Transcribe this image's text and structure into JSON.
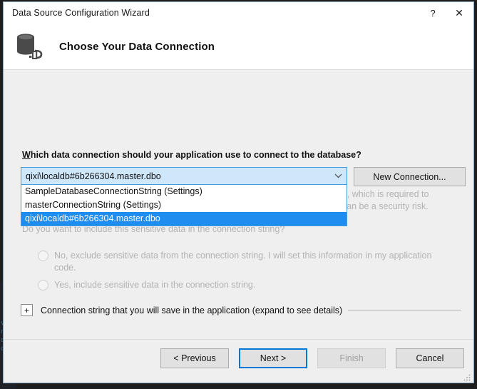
{
  "window": {
    "title": "Data Source Configuration Wizard",
    "help_label": "?",
    "close_label": "✕"
  },
  "header": {
    "title": "Choose Your Data Connection",
    "icon": "database-connection-icon"
  },
  "main": {
    "question_label_prefix": "W",
    "question_label_rest": "hich data connection should your application use to connect to the database?",
    "combo": {
      "value": "qixi\\localdb#6b266304.master.dbo",
      "placeholder": "qixi\\localdb#6b266304.master.dbo",
      "arrow_icon": "chevron-down-icon",
      "expanded": true,
      "options": [
        {
          "label": "SampleDatabaseConnectionString (Settings)",
          "selected": false
        },
        {
          "label": "masterConnectionString (Settings)",
          "selected": false
        },
        {
          "label": "qixi\\localdb#6b266304.master.dbo",
          "selected": true
        }
      ]
    },
    "new_connection_label": "New Connection...",
    "sensitive_paragraph": "This connection string appears to contain sensitive data (for example, a password), which is required to connect to the database. However, storing sensitive data in the connection string can be a security risk.",
    "sensitive_question": "Do you want to include this sensitive data in the connection string?",
    "radios": [
      {
        "id": "exclude-sensitive",
        "label": "No, exclude sensitive data from the connection string. I will set this information in my application code.",
        "selected": false,
        "disabled": true
      },
      {
        "id": "include-sensitive",
        "label": "Yes, include sensitive data in the connection string.",
        "selected": false,
        "disabled": true
      }
    ],
    "expander": {
      "toggle_label": "+",
      "text": "Connection string that you will save in the application (expand to see details)",
      "expanded": false
    }
  },
  "footer": {
    "buttons": [
      {
        "id": "previous",
        "label": "< Previous",
        "state": "normal"
      },
      {
        "id": "next",
        "label": "Next >",
        "state": "default-focused"
      },
      {
        "id": "finish",
        "label": "Finish",
        "state": "disabled"
      },
      {
        "id": "cancel",
        "label": "Cancel",
        "state": "normal"
      }
    ]
  },
  "backdrop": {
    "code_lines": [
      "v'",
      "nv",
      "co",
      "dtr"
    ]
  },
  "colors": {
    "accent": "#1f8cef",
    "focus_border": "#0078d7",
    "combo_fill": "#cfe7fa",
    "dialog_bg": "#efeff0",
    "disabled_text": "#b3b3b3",
    "editor_bg": "#1e1e1e"
  }
}
